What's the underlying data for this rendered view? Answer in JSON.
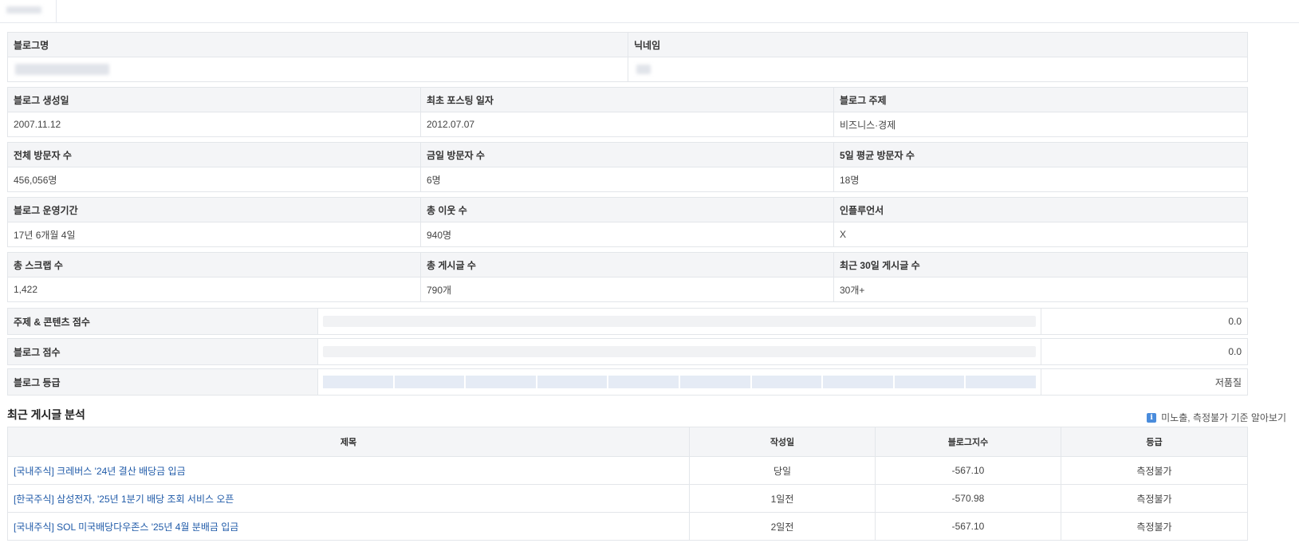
{
  "info_rows": [
    {
      "headers": [
        "블로그명",
        "닉네임"
      ],
      "values": [
        "",
        ""
      ]
    },
    {
      "headers": [
        "블로그 생성일",
        "최초 포스팅 일자",
        "블로그 주제"
      ],
      "values": [
        "2007.11.12",
        "2012.07.07",
        "비즈니스·경제"
      ]
    },
    {
      "headers": [
        "전체 방문자 수",
        "금일 방문자 수",
        "5일 평균 방문자 수"
      ],
      "values": [
        "456,056명",
        "6명",
        "18명"
      ]
    },
    {
      "headers": [
        "블로그 운영기간",
        "총 이웃 수",
        "인플루언서"
      ],
      "values": [
        "17년 6개월 4일",
        "940명",
        "X"
      ]
    },
    {
      "headers": [
        "총 스크랩 수",
        "총 게시글 수",
        "최근 30일 게시글 수"
      ],
      "values": [
        "1,422",
        "790개",
        "30개+"
      ]
    }
  ],
  "scores": [
    {
      "label": "주제 & 콘텐츠 점수",
      "value": "0.0",
      "fill": 0
    },
    {
      "label": "블로그 점수",
      "value": "0.0",
      "fill": 0
    },
    {
      "label": "블로그 등급",
      "value": "저품질",
      "segments": 10
    }
  ],
  "recent_posts": {
    "section_title": "최근 게시글 분석",
    "help_text": "미노출, 측정불가 기준 알아보기",
    "help_icon": "info-icon",
    "columns": [
      "제목",
      "작성일",
      "블로그지수",
      "등급"
    ],
    "rows": [
      {
        "title": "[국내주식] 크레버스 '24년 결산 배당금 입금",
        "date": "당일",
        "index": "-567.10",
        "grade": "측정불가"
      },
      {
        "title": "[한국주식] 삼성전자, '25년 1분기 배당 조회 서비스 오픈",
        "date": "1일전",
        "index": "-570.98",
        "grade": "측정불가"
      },
      {
        "title": "[국내주식] SOL 미국배당다우존스 '25년 4월 분배금 입금",
        "date": "2일전",
        "index": "-567.10",
        "grade": "측정불가"
      }
    ]
  },
  "colors": {
    "link": "#1f5aa8",
    "header_bg": "#f4f5f7",
    "grade_segment": "#e5ebf5",
    "info_icon": "#4a8cdc"
  }
}
